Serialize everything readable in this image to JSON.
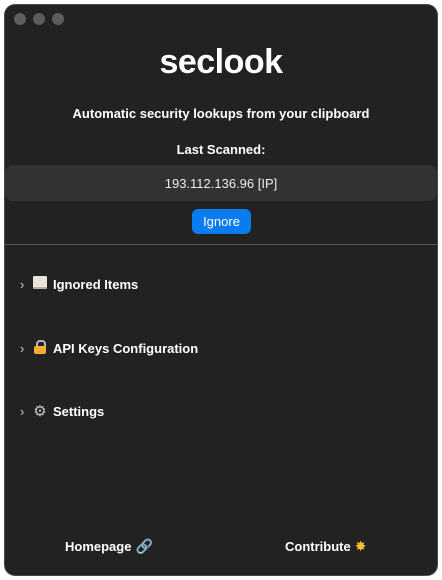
{
  "app": {
    "title": "seclook",
    "tagline": "Automatic security lookups from your clipboard"
  },
  "scan": {
    "label": "Last Scanned:",
    "value": "193.112.136.96 [IP]",
    "ignore_label": "Ignore"
  },
  "sections": [
    {
      "label": "Ignored Items",
      "icon": "book-icon"
    },
    {
      "label": "API Keys Configuration",
      "icon": "lock-with-key-icon"
    },
    {
      "label": "Settings",
      "icon": "gear-icon"
    }
  ],
  "footer": {
    "homepage_label": "Homepage",
    "homepage_icon": "link-icon",
    "contribute_label": "Contribute",
    "contribute_icon": "star-icon"
  },
  "colors": {
    "window_bg": "#222223",
    "accent": "#0a7cf0",
    "panel_bg": "#323234"
  }
}
